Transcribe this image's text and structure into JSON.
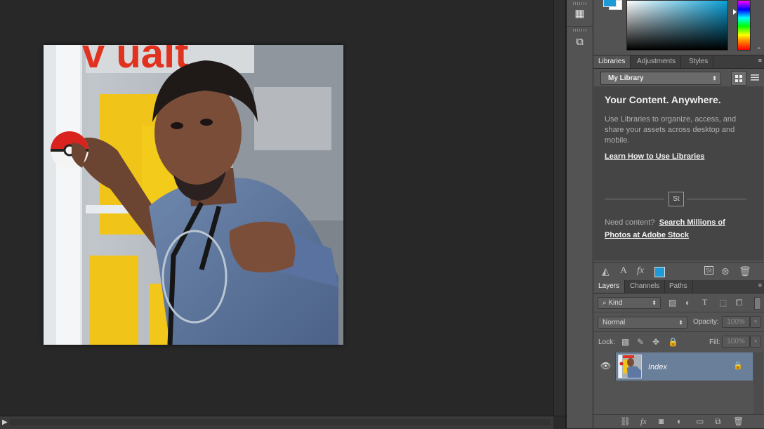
{
  "libraries_panel": {
    "tabs": [
      "Libraries",
      "Adjustments",
      "Styles"
    ],
    "active_tab": "Libraries",
    "library_select": "My Library",
    "heading": "Your Content. Anywhere.",
    "description": "Use Libraries to organize, access, and share your assets across desktop and mobile.",
    "learn_link": "Learn How to Use Libraries",
    "stock_badge": "St",
    "need_content": "Need content?",
    "stock_link": "Search Millions of Photos at Adobe Stock"
  },
  "layers_panel": {
    "tabs": [
      "Layers",
      "Channels",
      "Paths"
    ],
    "active_tab": "Layers",
    "filter_kind": "Kind",
    "blend_mode": "Normal",
    "opacity_label": "Opacity:",
    "opacity_value": "100%",
    "lock_label": "Lock:",
    "fill_label": "Fill:",
    "fill_value": "100%",
    "layer": {
      "name": "Index",
      "visible": true,
      "locked": true
    }
  },
  "colors": {
    "foreground": "#1e9bd7",
    "background": "#ffffff",
    "selected_layer_bg": "#6a7f99"
  },
  "stock_tool_badge": "St"
}
